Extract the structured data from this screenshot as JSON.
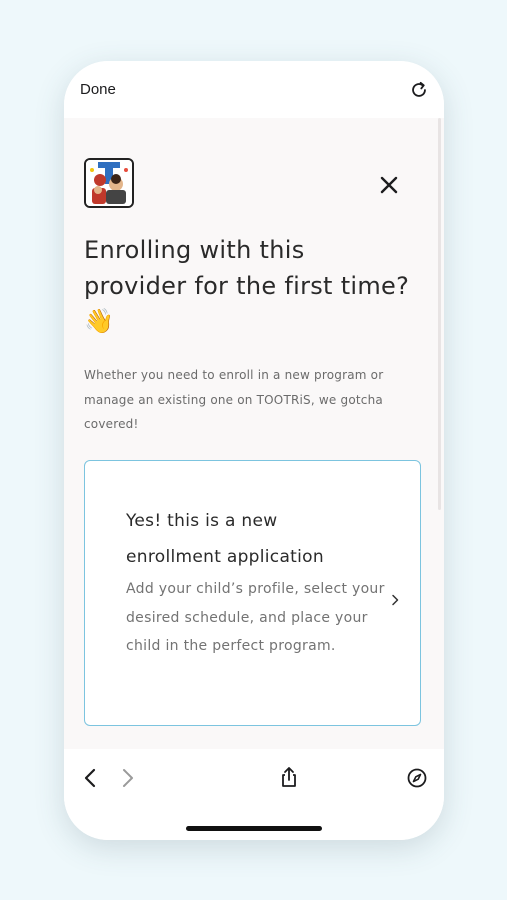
{
  "browser": {
    "done_label": "Done"
  },
  "page": {
    "headline": "Enrolling with this provider for the first time? 👋",
    "subtext": "Whether you need to enroll in a new program or manage an existing one on TOOTRiS, we gotcha covered!",
    "card": {
      "title": "Yes! this is a new enrollment application",
      "description": "Add your child’s profile, select your desired schedule, and place your child in the perfect program."
    }
  },
  "icons": {
    "reload": "reload-icon",
    "close": "close-icon",
    "chevron": "chevron-right-icon",
    "back": "back-arrow-icon",
    "forward": "forward-arrow-icon",
    "share": "share-icon",
    "compass": "compass-icon"
  },
  "colors": {
    "background": "#eef8fb",
    "content_bg": "#faf8f8",
    "card_border": "#7cc4df",
    "text_dark": "#2a2a2a",
    "text_muted": "#737373"
  }
}
